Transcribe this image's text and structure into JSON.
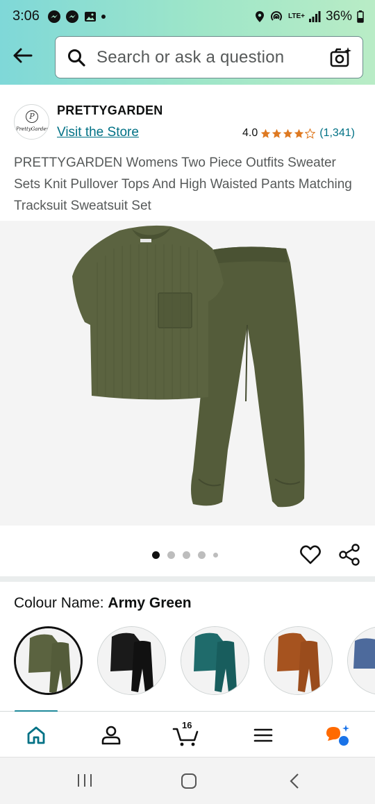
{
  "status_bar": {
    "time": "3:06",
    "battery": "36%",
    "network": "LTE+"
  },
  "search": {
    "placeholder": "Search or ask a question"
  },
  "brand": {
    "name": "PRETTYGARDEN",
    "logo_text": "PrettyGarden",
    "logo_letter": "P",
    "visit_store": "Visit the Store",
    "rating_value": "4.0",
    "rating_stars": 4,
    "rating_count": "(1,341)"
  },
  "product": {
    "title": "PRETTYGARDEN Womens Two Piece Outfits Sweater Sets Knit Pullover Tops And High Waisted Pants Matching Tracksuit Sweatsuit Set"
  },
  "carousel": {
    "total_images": 5,
    "active_index": 0
  },
  "colour": {
    "label": "Colour Name:",
    "selected": "Army Green",
    "options": [
      "Army Green",
      "Black",
      "Teal",
      "Brown",
      "Blue"
    ]
  },
  "bottom_nav": {
    "cart_count": "16",
    "items": [
      "home",
      "account",
      "cart",
      "menu",
      "rufus"
    ]
  },
  "colors": {
    "accent": "#007185",
    "star": "#de7921",
    "army_green": "#545c3a",
    "header_start": "#7fd8d8",
    "header_end": "#b9ecc6"
  }
}
